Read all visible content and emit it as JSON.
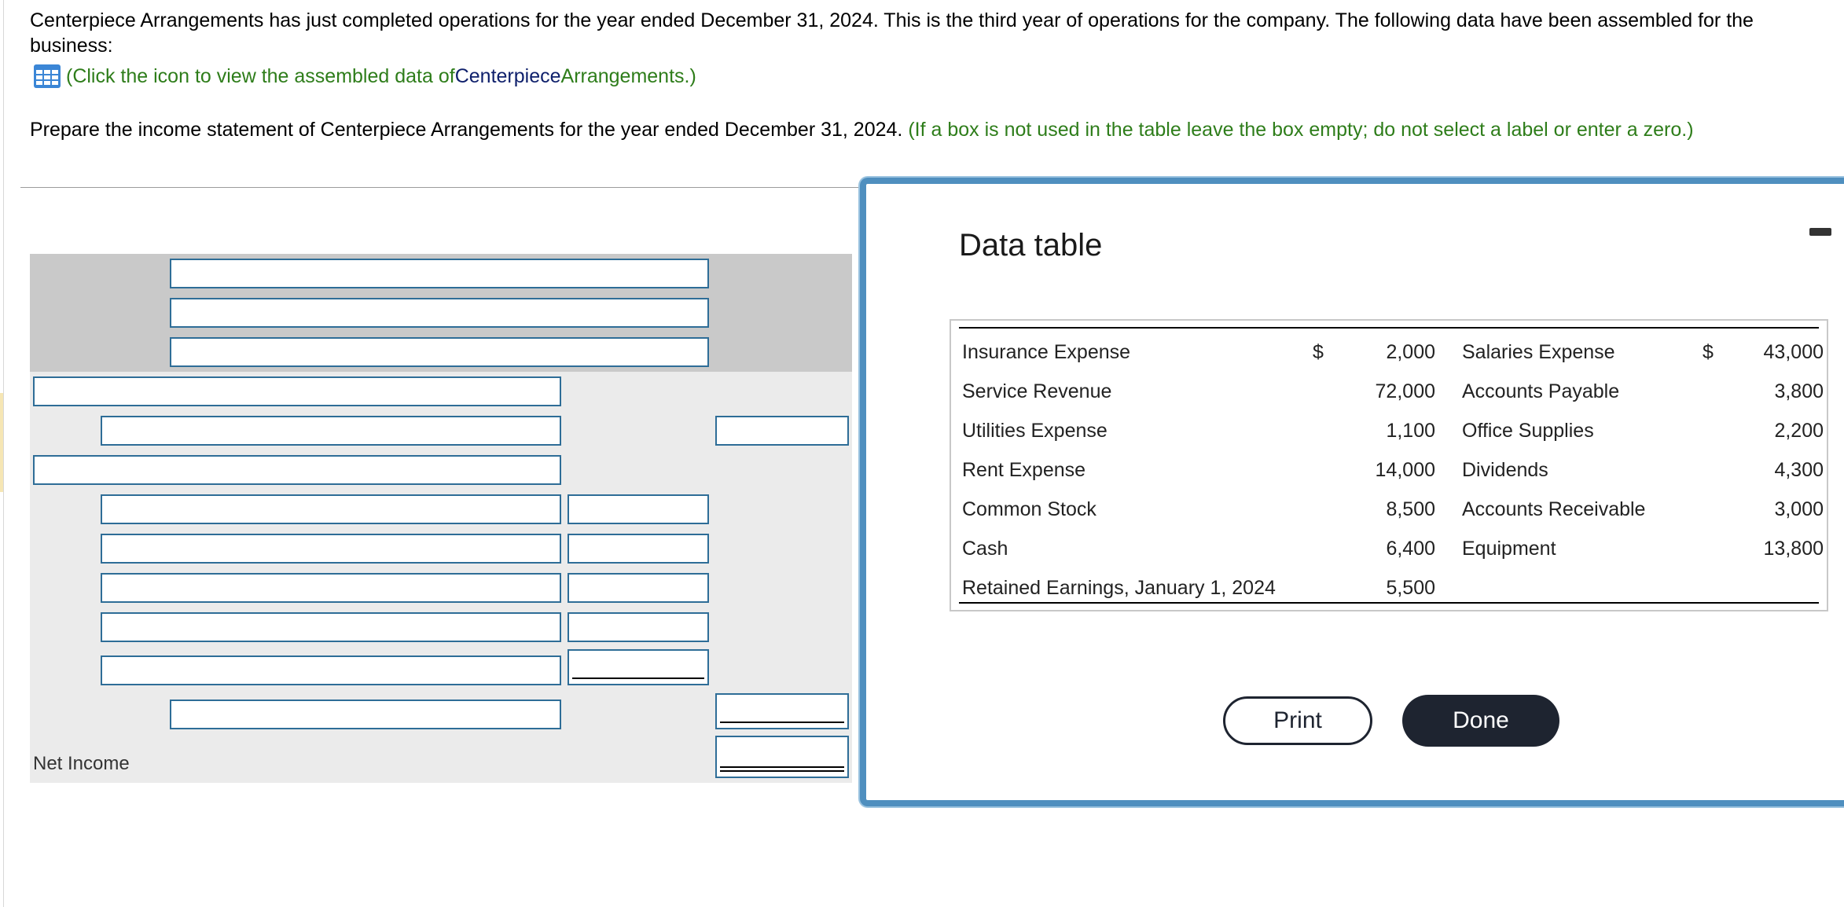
{
  "intro": {
    "text": "Centerpiece Arrangements has just completed operations for the year ended December 31, 2024. This is the third year of operations for the company. The following data have been assembled for the business:"
  },
  "icon_link": {
    "icon": "table-grid-icon",
    "prefix": "(Click the icon to view the assembled data of ",
    "name_part": "Centerpiece",
    "suffix": " Arrangements.)"
  },
  "prepare": {
    "text": "Prepare the income statement of Centerpiece Arrangements for the year ended December 31, 2024.",
    "hint": "(If a box is not used in the table leave the box empty; do not select a label or enter a zero.)"
  },
  "statement": {
    "net_income_label": "Net Income"
  },
  "modal": {
    "title": "Data table",
    "rows": [
      {
        "left_label": "Insurance Expense",
        "left_dollar": "$",
        "left_value": "2,000",
        "right_label": "Salaries Expense",
        "right_dollar": "$",
        "right_value": "43,000"
      },
      {
        "left_label": "Service Revenue",
        "left_dollar": "",
        "left_value": "72,000",
        "right_label": "Accounts Payable",
        "right_dollar": "",
        "right_value": "3,800"
      },
      {
        "left_label": "Utilities Expense",
        "left_dollar": "",
        "left_value": "1,100",
        "right_label": "Office Supplies",
        "right_dollar": "",
        "right_value": "2,200"
      },
      {
        "left_label": "Rent Expense",
        "left_dollar": "",
        "left_value": "14,000",
        "right_label": "Dividends",
        "right_dollar": "",
        "right_value": "4,300"
      },
      {
        "left_label": "Common Stock",
        "left_dollar": "",
        "left_value": "8,500",
        "right_label": "Accounts Receivable",
        "right_dollar": "",
        "right_value": "3,000"
      },
      {
        "left_label": "Cash",
        "left_dollar": "",
        "left_value": "6,400",
        "right_label": "Equipment",
        "right_dollar": "",
        "right_value": "13,800"
      },
      {
        "left_label": "Retained Earnings, January 1, 2024",
        "left_dollar": "",
        "left_value": "5,500",
        "right_label": "",
        "right_dollar": "",
        "right_value": ""
      }
    ],
    "print_label": "Print",
    "done_label": "Done"
  }
}
